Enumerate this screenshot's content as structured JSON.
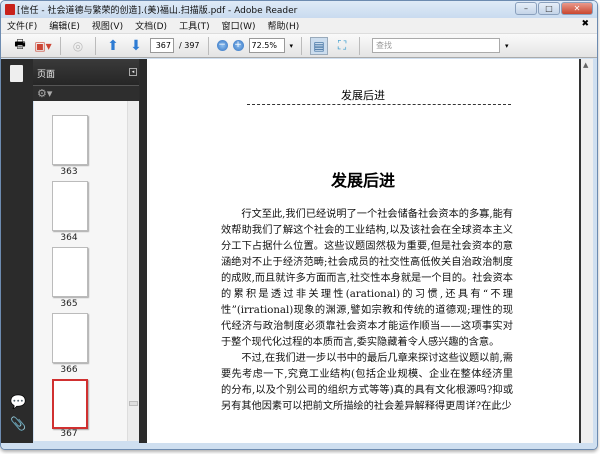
{
  "window": {
    "title": "[信任 - 社会道德与繁荣的创造].(美)福山.扫描版.pdf - Adobe Reader",
    "minimize": "–",
    "maximize": "□",
    "close": "✕"
  },
  "menu": [
    "文件(F)",
    "编辑(E)",
    "视图(V)",
    "文档(D)",
    "工具(T)",
    "窗口(W)",
    "帮助(H)"
  ],
  "menu_close": "✖",
  "toolbar": {
    "current_page": "367",
    "total_pages": "/ 397",
    "zoom": "72.5%",
    "search_placeholder": "查找"
  },
  "sidebar": {
    "panel_title": "页面",
    "thumbnails": [
      {
        "label": "363"
      },
      {
        "label": "364"
      },
      {
        "label": "365"
      },
      {
        "label": "366"
      },
      {
        "label": "367",
        "selected": true
      }
    ]
  },
  "document": {
    "running_head": "发展后进",
    "chapter_title": "发展后进",
    "paragraphs": [
      "行文至此,我们已经说明了一个社会储备社会资本的多寡,能有效帮助我们了解这个社会的工业结构,以及该社会在全球资本主义分工下占据什么位置。这些议题固然极为重要,但是社会资本的意涵绝对不止于经济范畴;社会成员的社交性高低攸关自治政治制度的成败,而且就许多方面而言,社交性本身就是一个目的。社会资本的累积是透过非关理性(arational)的习惯,还具有“不理性”(irrational)现象的渊源,譬如宗教和传统的道德观;理性的现代经济与政治制度必须靠社会资本才能运作顺当——这项事实对于整个现代化过程的本质而言,委实隐藏着令人感兴趣的含意。",
      "不过,在我们进一步以书中的最后几章来探讨这些议题以前,需要先考虑一下,究竟工业结构(包括企业规模、企业在整体经济里的分布,以及个别公司的组织方式等等)真的具有文化根源吗?抑或另有其他因素可以把前文所描绘的社会差异解释得更周详?在此少"
    ]
  }
}
